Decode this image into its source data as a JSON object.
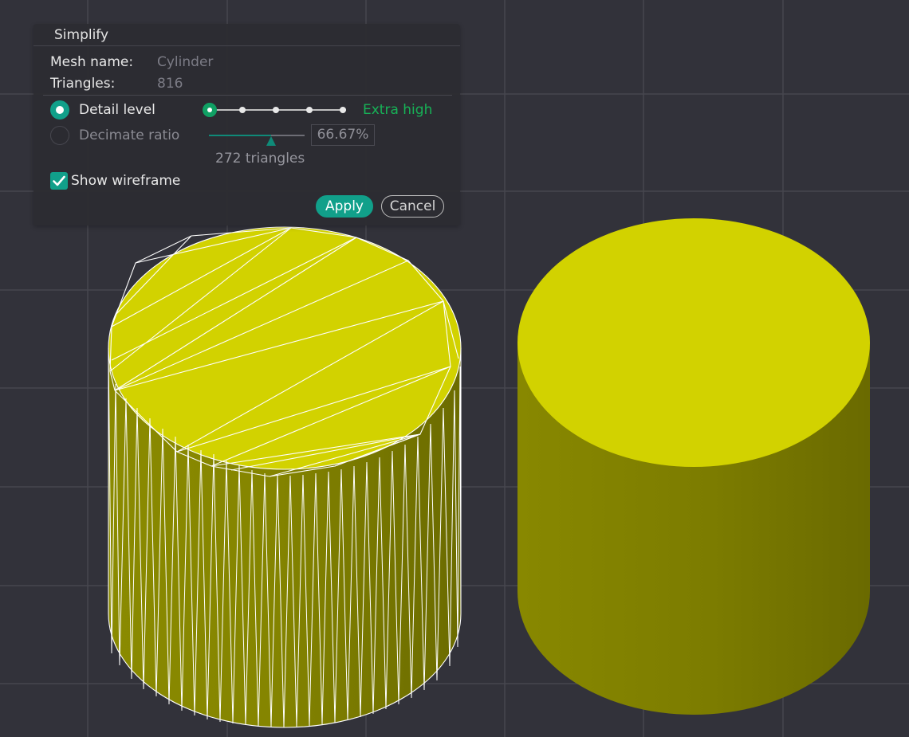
{
  "dialog": {
    "title": "Simplify",
    "mesh_name_label": "Mesh name:",
    "mesh_name_value": "Cylinder",
    "triangles_label": "Triangles:",
    "triangles_value": "816",
    "detail_level": {
      "label": "Detail level",
      "selected": true,
      "levels_count": 5,
      "selected_index": 0,
      "value": "Extra high"
    },
    "decimate_ratio": {
      "label": "Decimate ratio",
      "selected": false,
      "slider_fraction": 0.6667,
      "value": "66.67%"
    },
    "result_triangles": "272 triangles",
    "show_wireframe": {
      "label": "Show wireframe",
      "checked": true
    },
    "apply_label": "Apply",
    "cancel_label": "Cancel"
  },
  "scene": {
    "objects": [
      {
        "name": "simplified-cylinder",
        "wireframe": true
      },
      {
        "name": "original-cylinder",
        "wireframe": false
      }
    ],
    "colors": {
      "background": "#32323a",
      "grid": "#45454d",
      "mesh_top": "#d2d200",
      "mesh_side": "#878700",
      "wire": "#ffffff",
      "accent": "#11a08a",
      "detail_value": "#17b257"
    }
  }
}
